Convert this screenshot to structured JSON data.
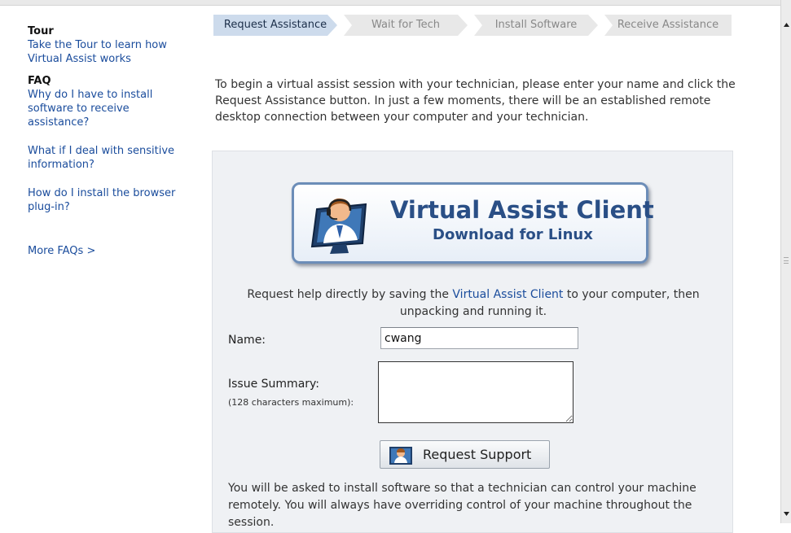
{
  "sidebar": {
    "tour": {
      "heading": "Tour",
      "link": "Take the Tour to learn how Virtual Assist works"
    },
    "faq": {
      "heading": "FAQ",
      "links": [
        "Why do I have to install software to receive assistance?",
        "What if I deal with sensitive information?",
        "How do I install the browser plug-in?"
      ]
    },
    "more_faqs": "More FAQs >"
  },
  "steps": [
    {
      "label": "Request Assistance",
      "active": true
    },
    {
      "label": "Wait for Tech",
      "active": false
    },
    {
      "label": "Install Software",
      "active": false
    },
    {
      "label": "Receive Assistance",
      "active": false
    }
  ],
  "intro": "To begin a virtual assist session with your technician, please enter your name and click the Request Assistance button. In just a few moments, there will be an established remote desktop connection between your computer and your technician.",
  "download": {
    "title": "Virtual Assist Client",
    "subtitle": "Download for Linux",
    "icon": "technician-headset-icon"
  },
  "help": {
    "before": "Request help directly by saving the ",
    "link": "Virtual Assist Client",
    "after": " to your computer, then unpacking and running it."
  },
  "form": {
    "name_label": "Name:",
    "name_value": "cwang",
    "issue_label": "Issue Summary:",
    "issue_hint": "(128 characters maximum):",
    "issue_value": "",
    "submit_label": "Request Support"
  },
  "note": "You will be asked to install software so that a technician can control your machine remotely. You will always have overriding control of your machine throughout the session.",
  "colors": {
    "link": "#1a4c9c",
    "brand": "#2a4f86",
    "panel": "#eff1f4",
    "active_step": "#cddbec"
  }
}
